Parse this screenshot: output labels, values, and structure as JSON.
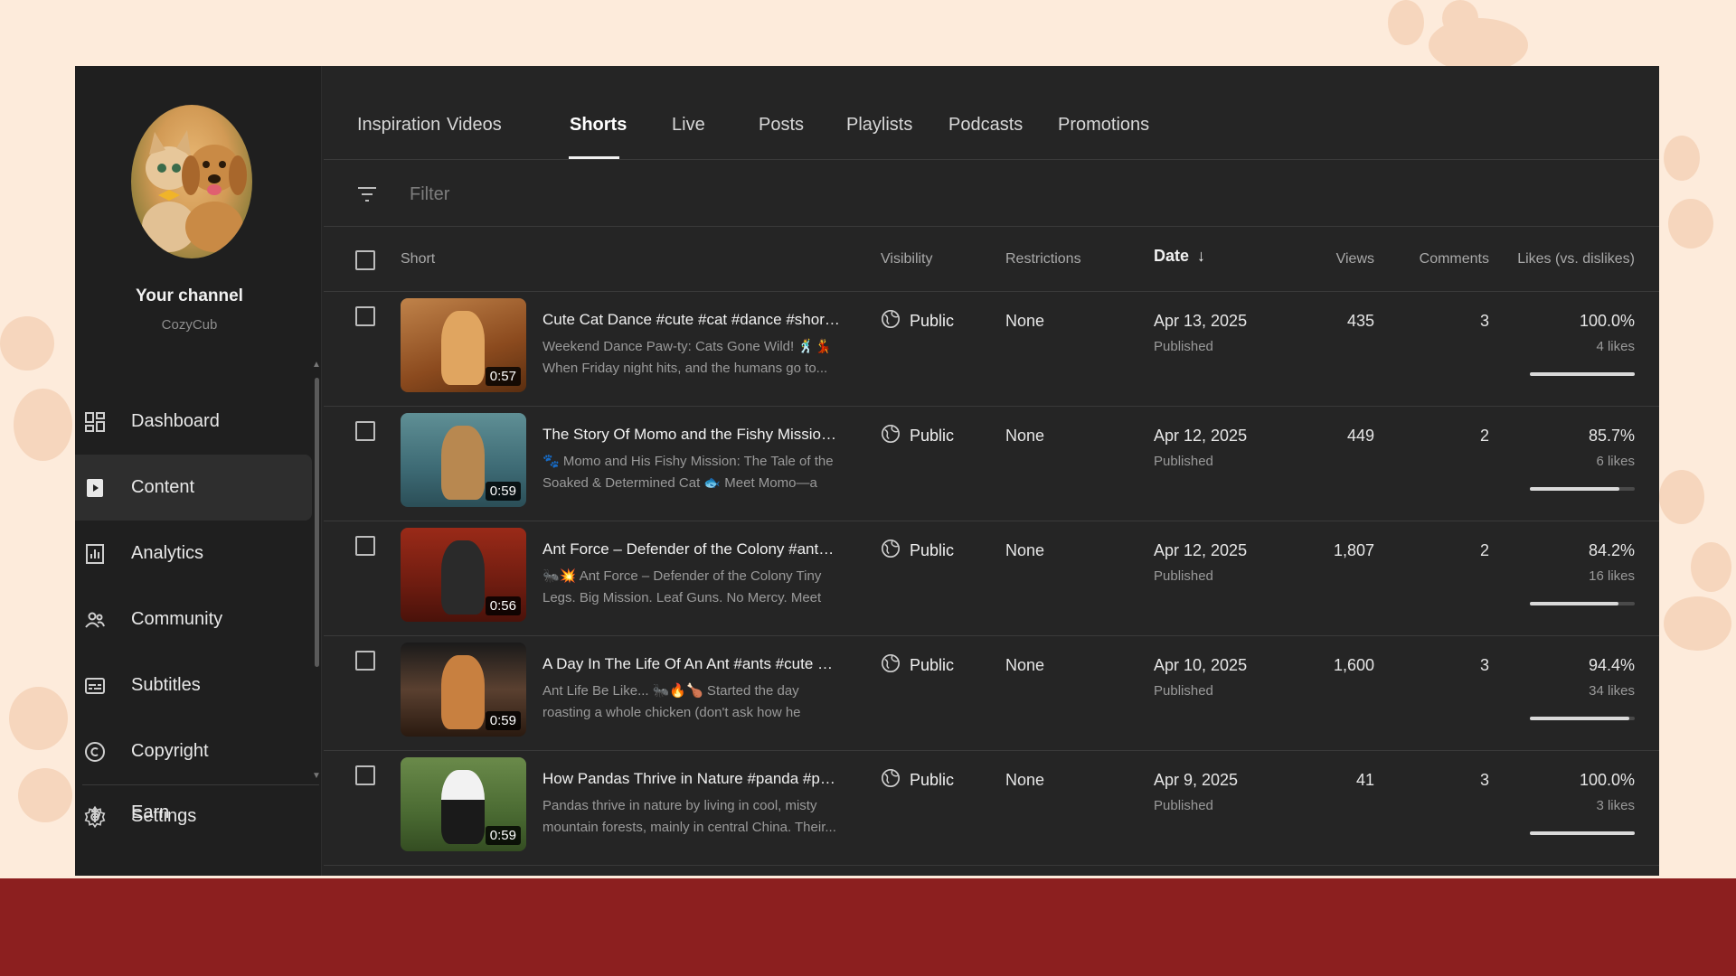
{
  "channel": {
    "name": "Your channel",
    "handle": "CozyCub"
  },
  "sidebar": {
    "items": [
      {
        "label": "Dashboard",
        "icon": "dashboard-icon"
      },
      {
        "label": "Content",
        "icon": "content-icon",
        "active": true
      },
      {
        "label": "Analytics",
        "icon": "analytics-icon"
      },
      {
        "label": "Community",
        "icon": "community-icon"
      },
      {
        "label": "Subtitles",
        "icon": "subtitles-icon"
      },
      {
        "label": "Copyright",
        "icon": "copyright-icon"
      },
      {
        "label": "Earn",
        "icon": "earn-icon"
      }
    ],
    "settings_label": "Settings"
  },
  "tabs": [
    "Inspiration",
    "Videos",
    "Shorts",
    "Live",
    "Posts",
    "Playlists",
    "Podcasts",
    "Promotions"
  ],
  "active_tab": "Shorts",
  "filter": {
    "placeholder": "Filter"
  },
  "table": {
    "headers": {
      "short": "Short",
      "visibility": "Visibility",
      "restrictions": "Restrictions",
      "date": "Date",
      "views": "Views",
      "comments": "Comments",
      "likes": "Likes (vs. dislikes)"
    },
    "rows": [
      {
        "title": "Cute Cat Dance #cute #cat #dance #shortvideo ...",
        "description": "Weekend Dance Paw-ty: Cats Gone Wild! 🕺💃 When Friday night hits, and the humans go to...",
        "duration": "0:57",
        "visibility": "Public",
        "restrictions": "None",
        "date": "Apr 13, 2025",
        "status": "Published",
        "views": "435",
        "comments": "3",
        "likes_pct": "100.0%",
        "likes_count": "4 likes",
        "likes_ratio": 1.0
      },
      {
        "title": "The Story Of Momo and the Fishy Mission #cat ...",
        "description": "🐾 Momo and His Fishy Mission: The Tale of the Soaked & Determined Cat 🐟 Meet Momo—a fluf...",
        "duration": "0:59",
        "visibility": "Public",
        "restrictions": "None",
        "date": "Apr 12, 2025",
        "status": "Published",
        "views": "449",
        "comments": "2",
        "likes_pct": "85.7%",
        "likes_count": "6 likes",
        "likes_ratio": 0.857
      },
      {
        "title": "Ant Force – Defender of the Colony #ants #ani...",
        "description": "🐜💥 Ant Force – Defender of the Colony Tiny Legs. Big Mission. Leaf Guns. No Mercy. Meet An...",
        "duration": "0:56",
        "visibility": "Public",
        "restrictions": "None",
        "date": "Apr 12, 2025",
        "status": "Published",
        "views": "1,807",
        "comments": "2",
        "likes_pct": "84.2%",
        "likes_count": "16 likes",
        "likes_ratio": 0.842
      },
      {
        "title": "A Day In The Life Of An Ant #ants #cute #anim...",
        "description": "Ant Life Be Like... 🐜🔥🍗 Started the day roasting a whole chicken (don't ask how he carrie...",
        "duration": "0:59",
        "visibility": "Public",
        "restrictions": "None",
        "date": "Apr 10, 2025",
        "status": "Published",
        "views": "1,600",
        "comments": "3",
        "likes_pct": "94.4%",
        "likes_count": "34 likes",
        "likes_ratio": 0.944
      },
      {
        "title": "How Pandas Thrive in Nature #panda #pandas...",
        "description": "Pandas thrive in nature by living in cool, misty mountain forests, mainly in central China. Their...",
        "duration": "0:59",
        "visibility": "Public",
        "restrictions": "None",
        "date": "Apr 9, 2025",
        "status": "Published",
        "views": "41",
        "comments": "3",
        "likes_pct": "100.0%",
        "likes_count": "3 likes",
        "likes_ratio": 1.0
      }
    ]
  },
  "colors": {
    "background": "#fdebdb",
    "bottom_band": "#8c1f1f",
    "app_bg": "#252525",
    "sidebar_bg": "#1f1f1f"
  }
}
